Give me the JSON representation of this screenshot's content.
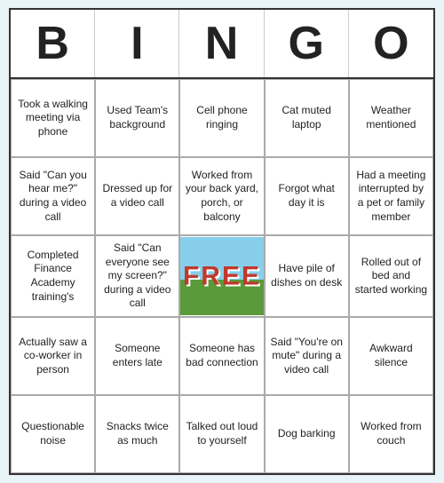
{
  "header": {
    "letters": [
      "B",
      "I",
      "N",
      "G",
      "O"
    ]
  },
  "cells": [
    {
      "text": "Took a walking meeting via phone"
    },
    {
      "text": "Used Team's background"
    },
    {
      "text": "Cell phone ringing"
    },
    {
      "text": "Cat muted laptop"
    },
    {
      "text": "Weather mentioned"
    },
    {
      "text": "Said \"Can you hear me?\" during a video call"
    },
    {
      "text": "Dressed up for a video call"
    },
    {
      "text": "Worked from your back yard, porch, or balcony"
    },
    {
      "text": "Forgot what day it is"
    },
    {
      "text": "Had a meeting interrupted by a pet or family member"
    },
    {
      "text": "Completed Finance Academy training's"
    },
    {
      "text": "Said \"Can everyone see my screen?\" during a video call"
    },
    {
      "text": "FREE",
      "free": true
    },
    {
      "text": "Have pile of dishes on desk"
    },
    {
      "text": "Rolled out of bed and started working"
    },
    {
      "text": "Actually saw a co-worker in person"
    },
    {
      "text": "Someone enters late"
    },
    {
      "text": "Someone has bad connection"
    },
    {
      "text": "Said \"You're on mute\" during a video call"
    },
    {
      "text": "Awkward silence"
    },
    {
      "text": "Questionable noise"
    },
    {
      "text": "Snacks twice as much"
    },
    {
      "text": "Talked out loud to yourself"
    },
    {
      "text": "Dog barking"
    },
    {
      "text": "Worked from couch"
    }
  ]
}
